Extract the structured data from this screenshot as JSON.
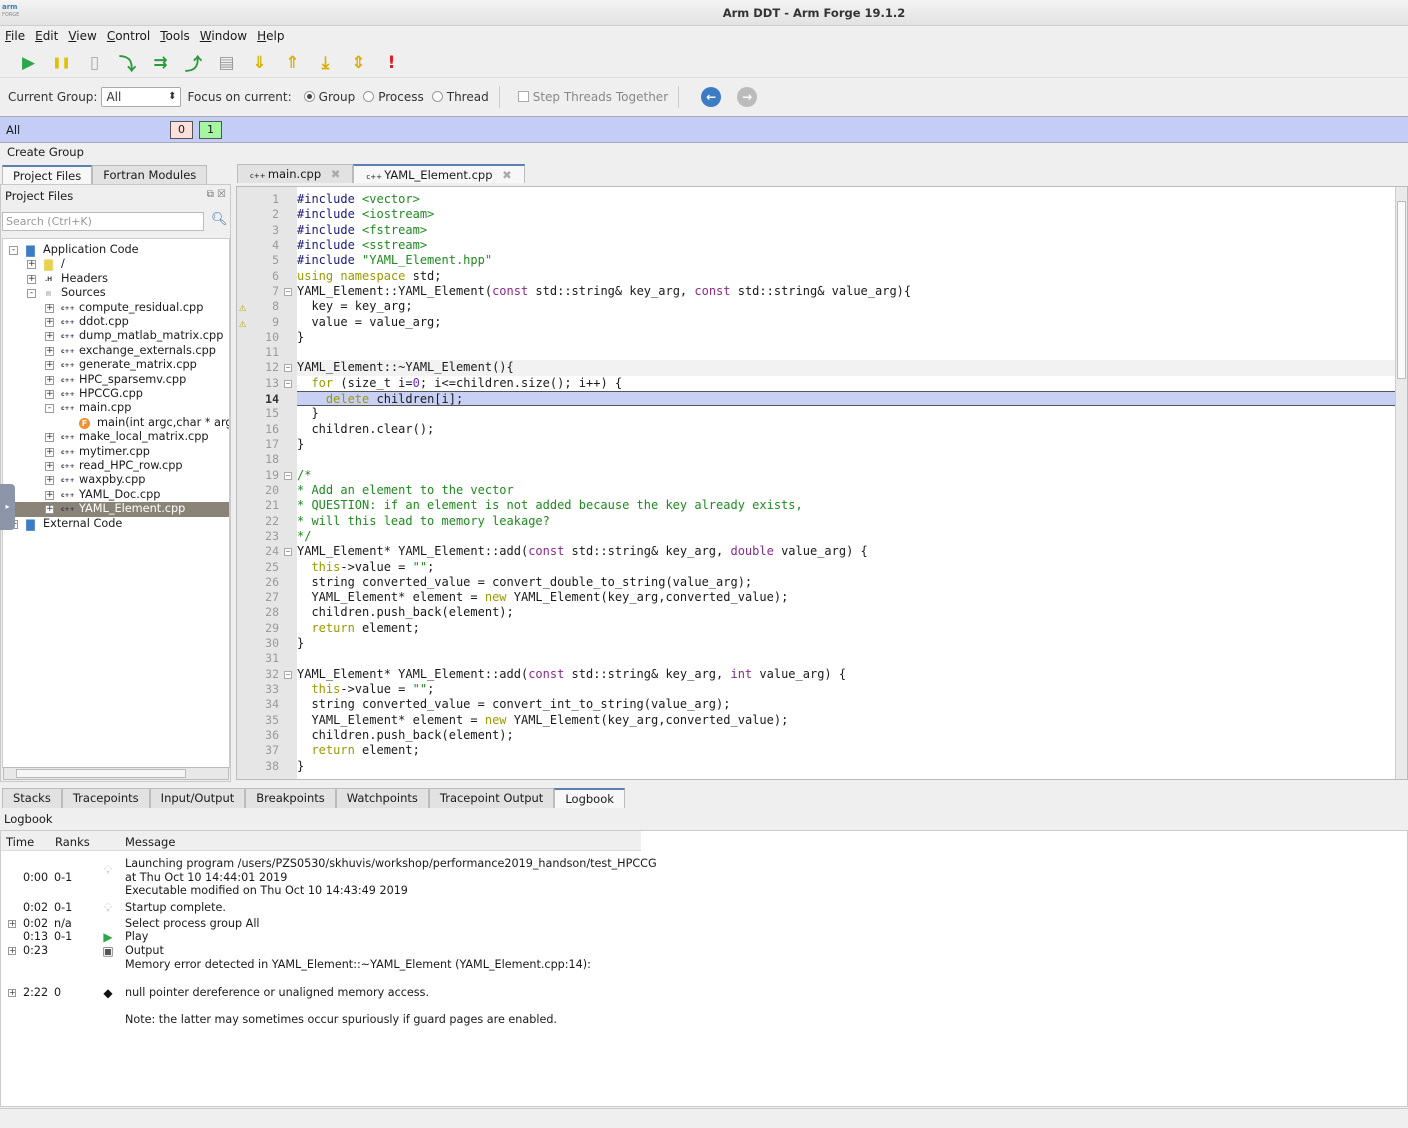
{
  "window": {
    "title": "Arm DDT - Arm Forge 19.1.2",
    "logo_line1": "arm",
    "logo_line2": "FORGE"
  },
  "menu": [
    "File",
    "Edit",
    "View",
    "Control",
    "Tools",
    "Window",
    "Help"
  ],
  "toolbar": [
    {
      "name": "play-icon",
      "glyph": "▶",
      "color": "#2aa84a"
    },
    {
      "name": "pause-icon",
      "glyph": "❚❚",
      "color": "#e0c000"
    },
    {
      "name": "add-breakpoint-icon",
      "glyph": "▯",
      "color": "#aaaaaa"
    },
    {
      "name": "step-into-icon",
      "glyph": "⤵",
      "color": "#2a9a3a"
    },
    {
      "name": "step-over-icon",
      "glyph": "⇉",
      "color": "#2a9a3a"
    },
    {
      "name": "step-out-icon",
      "glyph": "⤴",
      "color": "#2a9a3a"
    },
    {
      "name": "run-to-line-icon",
      "glyph": "▤",
      "color": "#999999"
    },
    {
      "name": "down-frame-icon",
      "glyph": "⇓",
      "color": "#d8b000"
    },
    {
      "name": "up-frame-icon",
      "glyph": "⇑",
      "color": "#d8b000"
    },
    {
      "name": "bottom-frame-icon",
      "glyph": "⤓",
      "color": "#d8b000"
    },
    {
      "name": "align-stacks-icon",
      "glyph": "⇕",
      "color": "#d8b000"
    },
    {
      "name": "error-icon",
      "glyph": "!",
      "color": "#e02020"
    }
  ],
  "groupbar": {
    "current_group_label": "Current Group:",
    "current_group_value": "All",
    "focus_label": "Focus on current:",
    "options": [
      {
        "label": "Group",
        "selected": true
      },
      {
        "label": "Process",
        "selected": false
      },
      {
        "label": "Thread",
        "selected": false
      }
    ],
    "step_threads": {
      "label": "Step Threads Together",
      "checked": false
    }
  },
  "process_group": {
    "label": "All",
    "processes": [
      {
        "rank": "0",
        "color": "#fbe0dc"
      },
      {
        "rank": "1",
        "color": "#a6f5a0"
      }
    ]
  },
  "create_group": "Create Group",
  "left": {
    "tabs": [
      {
        "label": "Project Files",
        "active": true
      },
      {
        "label": "Fortran Modules",
        "active": false
      }
    ],
    "panel_title": "Project Files",
    "search_placeholder": "Search (Ctrl+K)",
    "tree": [
      {
        "label": "Application Code",
        "depth": 0,
        "expander": "-",
        "icon": "app-code-icon"
      },
      {
        "label": "/",
        "depth": 1,
        "expander": "+",
        "icon": "folder-icon"
      },
      {
        "label": "Headers",
        "depth": 1,
        "expander": "+",
        "icon": "header-icon"
      },
      {
        "label": "Sources",
        "depth": 1,
        "expander": "-",
        "icon": "sources-icon"
      },
      {
        "label": "compute_residual.cpp",
        "depth": 2,
        "expander": "+",
        "icon": "cpp-file-icon"
      },
      {
        "label": "ddot.cpp",
        "depth": 2,
        "expander": "+",
        "icon": "cpp-file-icon"
      },
      {
        "label": "dump_matlab_matrix.cpp",
        "depth": 2,
        "expander": "+",
        "icon": "cpp-file-icon"
      },
      {
        "label": "exchange_externals.cpp",
        "depth": 2,
        "expander": "+",
        "icon": "cpp-file-icon"
      },
      {
        "label": "generate_matrix.cpp",
        "depth": 2,
        "expander": "+",
        "icon": "cpp-file-icon"
      },
      {
        "label": "HPC_sparsemv.cpp",
        "depth": 2,
        "expander": "+",
        "icon": "cpp-file-icon"
      },
      {
        "label": "HPCCG.cpp",
        "depth": 2,
        "expander": "+",
        "icon": "cpp-file-icon"
      },
      {
        "label": "main.cpp",
        "depth": 2,
        "expander": "-",
        "icon": "cpp-file-icon"
      },
      {
        "label": "main(int argc,char * argv",
        "depth": 3,
        "expander": "",
        "icon": "function-icon"
      },
      {
        "label": "make_local_matrix.cpp",
        "depth": 2,
        "expander": "+",
        "icon": "cpp-file-icon"
      },
      {
        "label": "mytimer.cpp",
        "depth": 2,
        "expander": "+",
        "icon": "cpp-file-icon"
      },
      {
        "label": "read_HPC_row.cpp",
        "depth": 2,
        "expander": "+",
        "icon": "cpp-file-icon"
      },
      {
        "label": "waxpby.cpp",
        "depth": 2,
        "expander": "+",
        "icon": "cpp-file-icon"
      },
      {
        "label": "YAML_Doc.cpp",
        "depth": 2,
        "expander": "+",
        "icon": "cpp-file-icon"
      },
      {
        "label": "YAML_Element.cpp",
        "depth": 2,
        "expander": "+",
        "icon": "cpp-file-icon",
        "selected": true
      },
      {
        "label": "External Code",
        "depth": 0,
        "expander": "+",
        "icon": "app-code-icon"
      }
    ]
  },
  "editor": {
    "tabs": [
      {
        "label": "main.cpp",
        "active": false
      },
      {
        "label": "YAML_Element.cpp",
        "active": true
      }
    ],
    "current_line": 14,
    "lines": [
      {
        "n": 1,
        "t": [
          [
            "#include ",
            "pre"
          ],
          [
            "<vector>",
            "inc"
          ]
        ]
      },
      {
        "n": 2,
        "t": [
          [
            "#include ",
            "pre"
          ],
          [
            "<iostream>",
            "inc"
          ]
        ]
      },
      {
        "n": 3,
        "t": [
          [
            "#include ",
            "pre"
          ],
          [
            "<fstream>",
            "inc"
          ]
        ]
      },
      {
        "n": 4,
        "t": [
          [
            "#include ",
            "pre"
          ],
          [
            "<sstream>",
            "inc"
          ]
        ]
      },
      {
        "n": 5,
        "t": [
          [
            "#include ",
            "pre"
          ],
          [
            "\"YAML_Element.hpp\"",
            "str"
          ]
        ]
      },
      {
        "n": 6,
        "t": [
          [
            "using namespace",
            "kw"
          ],
          [
            " std;",
            ""
          ]
        ]
      },
      {
        "n": 7,
        "fold": true,
        "t": [
          [
            "YAML_Element::YAML_Element(",
            ""
          ],
          [
            "const",
            "type"
          ],
          [
            " std::string& key_arg, ",
            ""
          ],
          [
            "const",
            "type"
          ],
          [
            " std::string& value_arg){",
            ""
          ]
        ]
      },
      {
        "n": 8,
        "warning": true,
        "t": [
          [
            "  key = key_arg;",
            ""
          ]
        ]
      },
      {
        "n": 9,
        "warning": true,
        "t": [
          [
            "  value = value_arg;",
            ""
          ]
        ]
      },
      {
        "n": 10,
        "t": [
          [
            "}",
            ""
          ]
        ]
      },
      {
        "n": 11,
        "t": []
      },
      {
        "n": 12,
        "fold": true,
        "t": [
          [
            "YAML_Element::~YAML_Element(){",
            ""
          ]
        ]
      },
      {
        "n": 13,
        "fold": true,
        "t": [
          [
            "  ",
            ""
          ],
          [
            "for",
            "kw"
          ],
          [
            " (size_t i=",
            ""
          ],
          [
            "0",
            "num"
          ],
          [
            "; i<=children.size(); i++) {",
            ""
          ]
        ]
      },
      {
        "n": 14,
        "t": [
          [
            "    ",
            ""
          ],
          [
            "delete",
            "kw"
          ],
          [
            " children[i];",
            ""
          ]
        ]
      },
      {
        "n": 15,
        "t": [
          [
            "  }",
            ""
          ]
        ]
      },
      {
        "n": 16,
        "t": [
          [
            "  children.clear();",
            ""
          ]
        ]
      },
      {
        "n": 17,
        "t": [
          [
            "}",
            ""
          ]
        ]
      },
      {
        "n": 18,
        "t": []
      },
      {
        "n": 19,
        "fold": true,
        "t": [
          [
            "/*",
            "com"
          ]
        ]
      },
      {
        "n": 20,
        "t": [
          [
            "* Add an element to the vector",
            "com"
          ]
        ]
      },
      {
        "n": 21,
        "t": [
          [
            "* QUESTION: if an element is not added because the key already exists,",
            "com"
          ]
        ]
      },
      {
        "n": 22,
        "t": [
          [
            "* will this lead to memory leakage?",
            "com"
          ]
        ]
      },
      {
        "n": 23,
        "t": [
          [
            "*/",
            "com"
          ]
        ]
      },
      {
        "n": 24,
        "fold": true,
        "t": [
          [
            "YAML_Element* YAML_Element::add(",
            ""
          ],
          [
            "const",
            "type"
          ],
          [
            " std::string& key_arg, ",
            ""
          ],
          [
            "double",
            "type"
          ],
          [
            " value_arg) {",
            ""
          ]
        ]
      },
      {
        "n": 25,
        "t": [
          [
            "  ",
            ""
          ],
          [
            "this",
            "kw"
          ],
          [
            "->value = ",
            ""
          ],
          [
            "\"\"",
            "str"
          ],
          [
            ";",
            ""
          ]
        ]
      },
      {
        "n": 26,
        "t": [
          [
            "  string converted_value = convert_double_to_string(value_arg);",
            ""
          ]
        ]
      },
      {
        "n": 27,
        "t": [
          [
            "  YAML_Element* element = ",
            ""
          ],
          [
            "new",
            "kw"
          ],
          [
            " YAML_Element(key_arg,converted_value);",
            ""
          ]
        ]
      },
      {
        "n": 28,
        "t": [
          [
            "  children.push_back(element);",
            ""
          ]
        ]
      },
      {
        "n": 29,
        "t": [
          [
            "  ",
            ""
          ],
          [
            "return",
            "kw"
          ],
          [
            " element;",
            ""
          ]
        ]
      },
      {
        "n": 30,
        "t": [
          [
            "}",
            ""
          ]
        ]
      },
      {
        "n": 31,
        "t": []
      },
      {
        "n": 32,
        "fold": true,
        "t": [
          [
            "YAML_Element* YAML_Element::add(",
            ""
          ],
          [
            "const",
            "type"
          ],
          [
            " std::string& key_arg, ",
            ""
          ],
          [
            "int",
            "type"
          ],
          [
            " value_arg) {",
            ""
          ]
        ]
      },
      {
        "n": 33,
        "t": [
          [
            "  ",
            ""
          ],
          [
            "this",
            "kw"
          ],
          [
            "->value = ",
            ""
          ],
          [
            "\"\"",
            "str"
          ],
          [
            ";",
            ""
          ]
        ]
      },
      {
        "n": 34,
        "t": [
          [
            "  string converted_value = convert_int_to_string(value_arg);",
            ""
          ]
        ]
      },
      {
        "n": 35,
        "t": [
          [
            "  YAML_Element* element = ",
            ""
          ],
          [
            "new",
            "kw"
          ],
          [
            " YAML_Element(key_arg,converted_value);",
            ""
          ]
        ]
      },
      {
        "n": 36,
        "t": [
          [
            "  children.push_back(element);",
            ""
          ]
        ]
      },
      {
        "n": 37,
        "t": [
          [
            "  ",
            ""
          ],
          [
            "return",
            "kw"
          ],
          [
            " element;",
            ""
          ]
        ]
      },
      {
        "n": 38,
        "t": [
          [
            "}",
            ""
          ]
        ]
      }
    ]
  },
  "bottom": {
    "tabs": [
      {
        "label": "Stacks"
      },
      {
        "label": "Tracepoints"
      },
      {
        "label": "Input/Output"
      },
      {
        "label": "Breakpoints"
      },
      {
        "label": "Watchpoints"
      },
      {
        "label": "Tracepoint Output"
      },
      {
        "label": "Logbook",
        "active": true
      }
    ],
    "logbook_title": "Logbook",
    "columns": [
      "Time",
      "Ranks",
      "Message"
    ],
    "entries": [
      {
        "time": "0:00",
        "ranks": "0-1",
        "icon": "lightbulb-icon",
        "expandable": false,
        "lines": [
          "Launching program /users/PZS0530/skhuvis/workshop/performance2019_handson/test_HPCCG",
          "at Thu Oct 10 14:44:01 2019",
          "Executable modified on Thu Oct 10 14:43:49 2019"
        ]
      },
      {
        "time": "0:02",
        "ranks": "0-1",
        "icon": "lightbulb-icon",
        "expandable": false,
        "lines": [
          "Startup complete."
        ]
      },
      {
        "time": "0:02",
        "ranks": "n/a",
        "icon": "",
        "expandable": true,
        "lines": [
          "Select process group All"
        ]
      },
      {
        "time": "0:13",
        "ranks": "0-1",
        "icon": "play-icon",
        "expandable": false,
        "lines": [
          "Play"
        ]
      },
      {
        "time": "0:23",
        "ranks": "",
        "icon": "output-icon",
        "expandable": true,
        "lines": [
          "Output",
          "Memory error detected in YAML_Element::~YAML_Element (YAML_Element.cpp:14):"
        ]
      },
      {
        "time": "2:22",
        "ranks": "0",
        "icon": "memory-chip-icon",
        "expandable": true,
        "lines": [
          "null pointer dereference or unaligned memory access.",
          "Note: the latter may sometimes occur spuriously if guard pages are enabled."
        ]
      }
    ]
  }
}
